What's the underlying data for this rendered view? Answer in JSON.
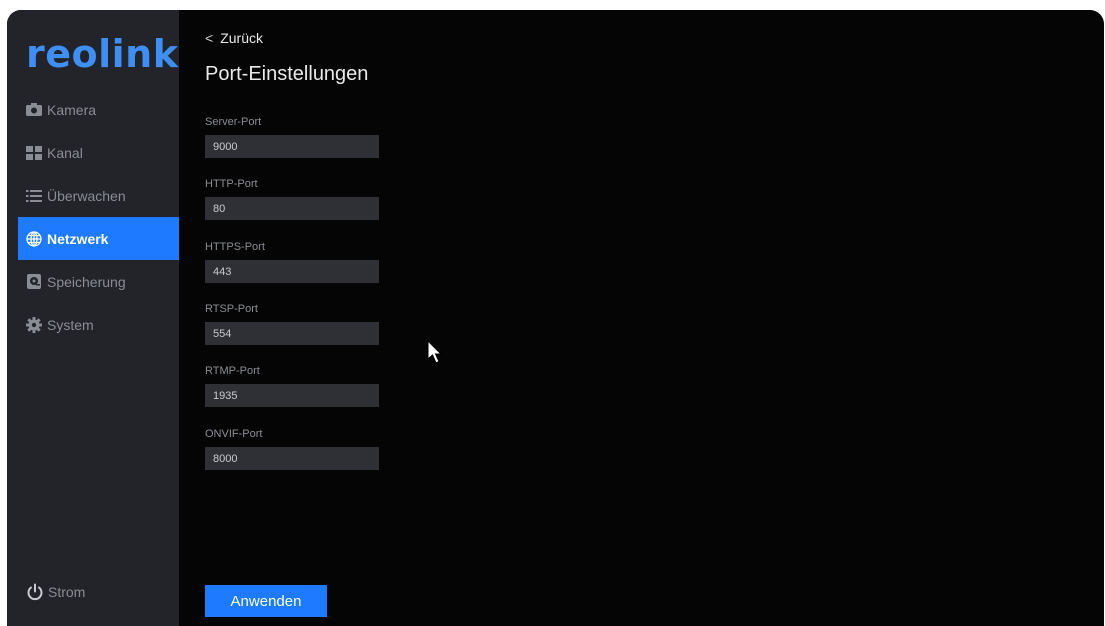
{
  "brand": {
    "logo_text": "reolink",
    "accent": "#1e7bff"
  },
  "sidebar": {
    "items": [
      {
        "label": "Kamera",
        "icon": "camera-icon",
        "active": false
      },
      {
        "label": "Kanal",
        "icon": "grid-icon",
        "active": false
      },
      {
        "label": "Überwachen",
        "icon": "list-icon",
        "active": false
      },
      {
        "label": "Netzwerk",
        "icon": "globe-icon",
        "active": true
      },
      {
        "label": "Speicherung",
        "icon": "hdd-icon",
        "active": false
      },
      {
        "label": "System",
        "icon": "gear-icon",
        "active": false
      }
    ],
    "power_label": "Strom"
  },
  "header": {
    "back_label": "Zurück",
    "title": "Port-Einstellungen"
  },
  "fields": [
    {
      "label": "Server-Port",
      "value": "9000"
    },
    {
      "label": "HTTP-Port",
      "value": "80"
    },
    {
      "label": "HTTPS-Port",
      "value": "443"
    },
    {
      "label": "RTSP-Port",
      "value": "554"
    },
    {
      "label": "RTMP-Port",
      "value": "1935"
    },
    {
      "label": "ONVIF-Port",
      "value": "8000"
    }
  ],
  "actions": {
    "apply_label": "Anwenden"
  }
}
